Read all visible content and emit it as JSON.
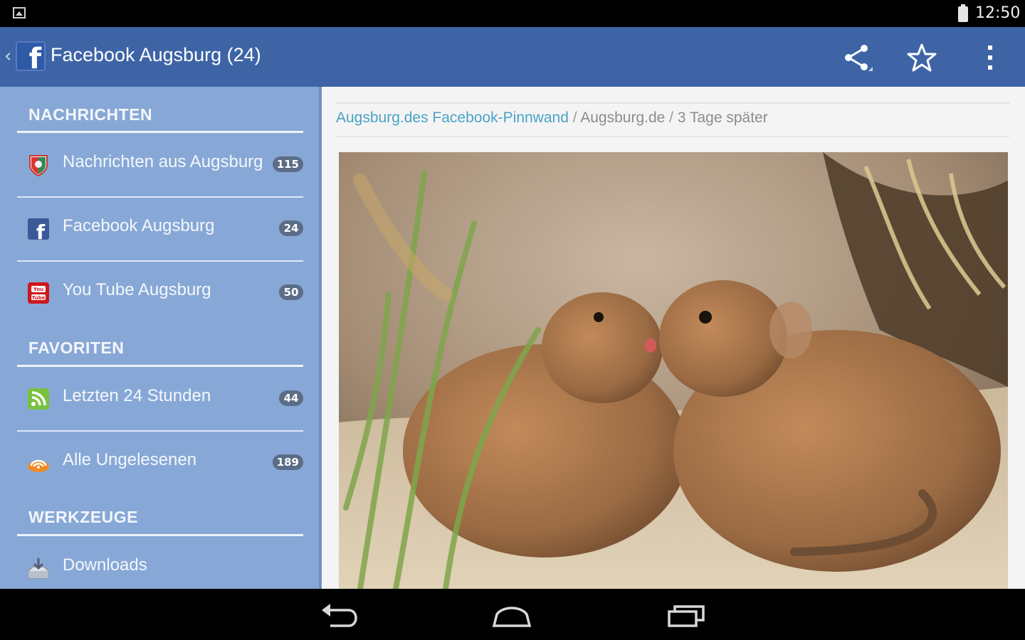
{
  "status_bar": {
    "time": "12:50",
    "left_icon": "image-icon",
    "battery_icon": "battery-icon"
  },
  "action_bar": {
    "title": "Facebook Augsburg (24)",
    "back_icon": "chevron-left-icon",
    "logo_icon": "facebook-icon",
    "actions": [
      "share-icon",
      "star-icon",
      "overflow-menu-icon"
    ],
    "background_color": "#3e64a6"
  },
  "drawer": {
    "background_color": "#87a8d6",
    "sections": [
      {
        "title": "NACHRICHTEN",
        "items": [
          {
            "label": "Nachrichten aus Augsburg",
            "count": "115",
            "icon": "city-crest-icon"
          },
          {
            "label": "Facebook Augsburg",
            "count": "24",
            "icon": "facebook-icon"
          },
          {
            "label": "You Tube Augsburg",
            "count": "50",
            "icon": "youtube-icon"
          }
        ]
      },
      {
        "title": "FAVORITEN",
        "items": [
          {
            "label": "Letzten 24 Stunden",
            "count": "44",
            "icon": "rss-icon"
          },
          {
            "label": "Alle Ungelesenen",
            "count": "189",
            "icon": "unread-feed-icon"
          }
        ]
      },
      {
        "title": "WERKZEUGE",
        "items": [
          {
            "label": "Downloads",
            "icon": "download-tray-icon"
          }
        ]
      }
    ]
  },
  "content": {
    "breadcrumb": {
      "link": "Augsburg.des Facebook-Pinnwand",
      "separator": " / ",
      "source": "Augsburg.de",
      "time": "3 Tage später"
    },
    "link_color": "#4aa3c8",
    "image_icon": "photo-two-mice"
  },
  "system_nav": {
    "buttons": [
      "back-arrow-icon",
      "home-icon",
      "recent-apps-icon"
    ]
  }
}
